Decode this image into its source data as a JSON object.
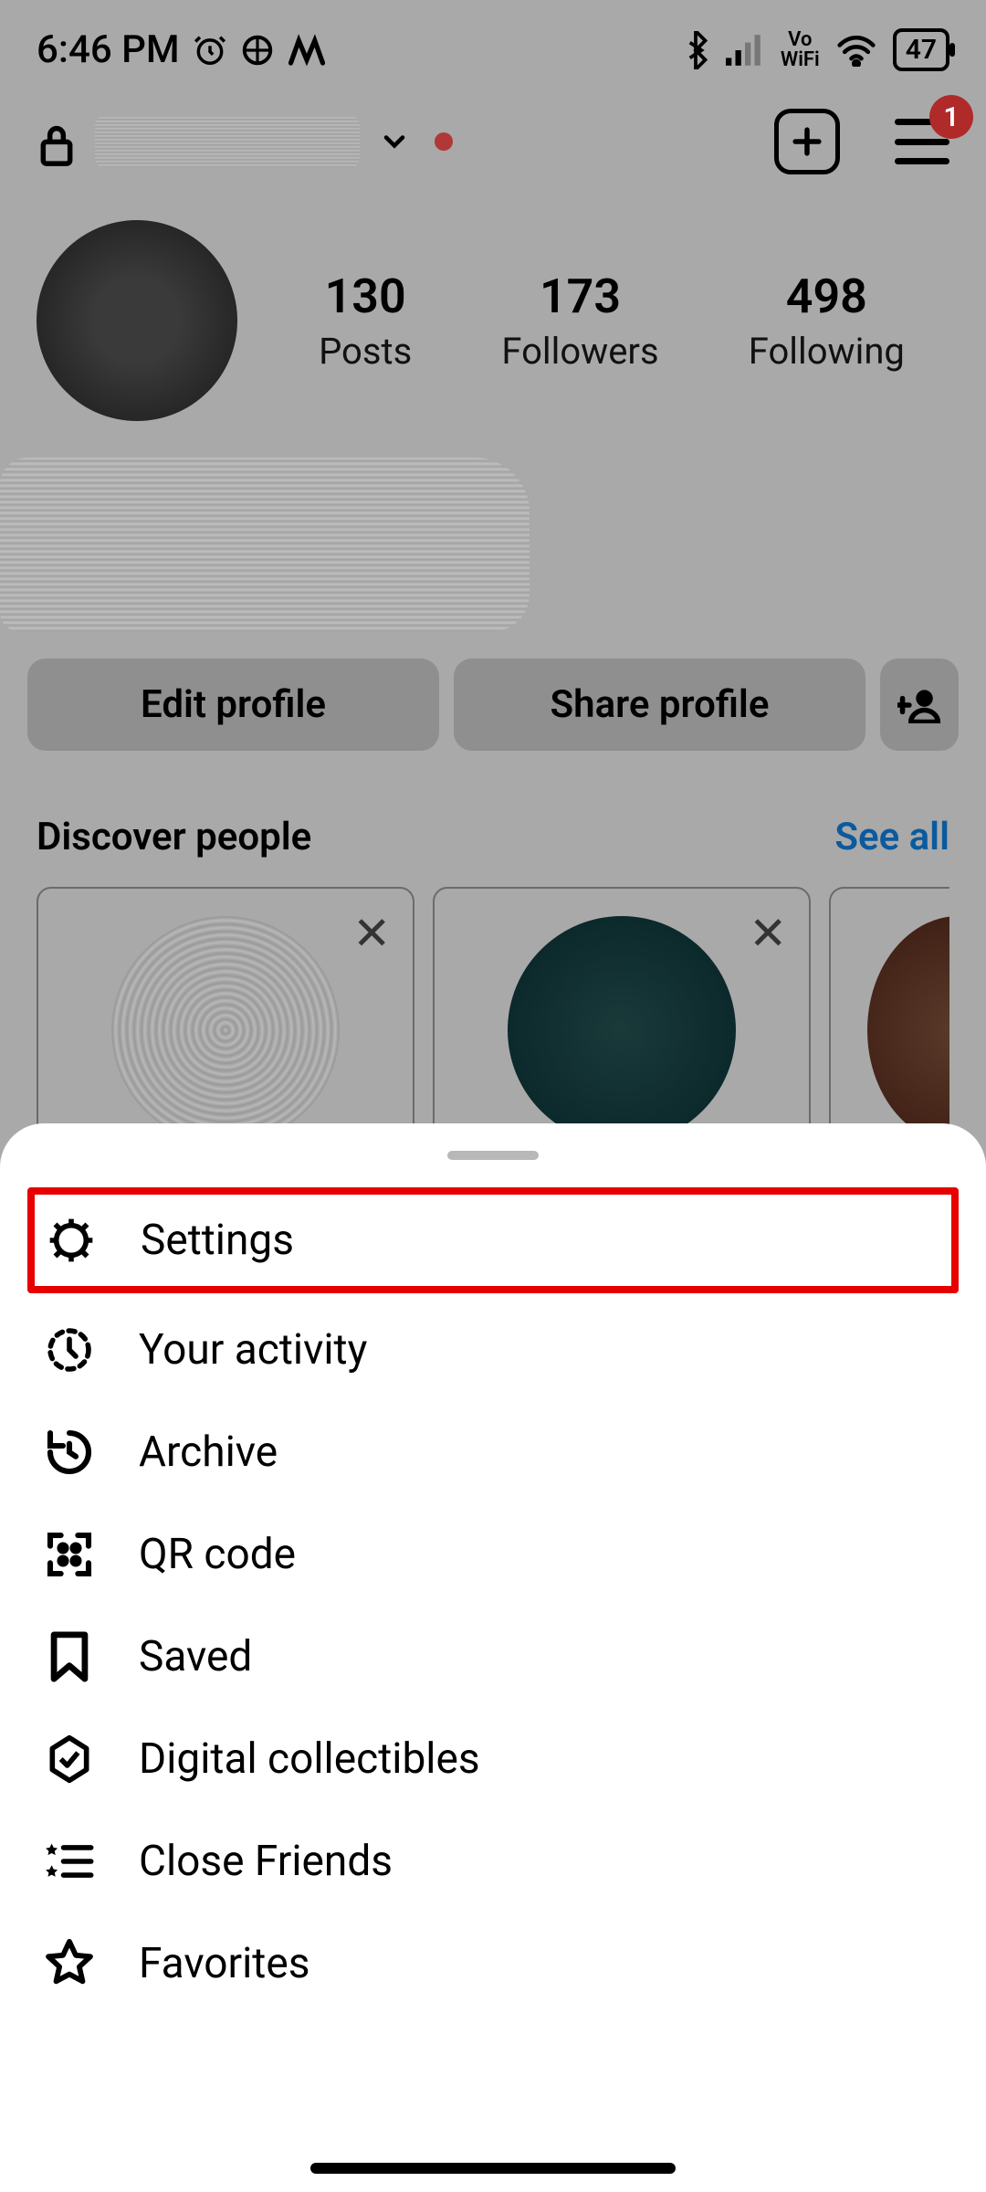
{
  "status": {
    "time": "6:46 PM",
    "alarm_icon": "alarm",
    "battery": "47",
    "vo": "Vo",
    "wifi_label": "WiFi"
  },
  "header": {
    "username_hidden": true,
    "badge_count": "1"
  },
  "stats": {
    "posts_num": "130",
    "posts_label": "Posts",
    "followers_num": "173",
    "followers_label": "Followers",
    "following_num": "498",
    "following_label": "Following"
  },
  "buttons": {
    "edit": "Edit profile",
    "share": "Share profile"
  },
  "discover": {
    "title": "Discover people",
    "see_all": "See all"
  },
  "menu": {
    "settings": "Settings",
    "activity": "Your activity",
    "archive": "Archive",
    "qr": "QR code",
    "saved": "Saved",
    "collectibles": "Digital collectibles",
    "close_friends": "Close Friends",
    "favorites": "Favorites"
  }
}
